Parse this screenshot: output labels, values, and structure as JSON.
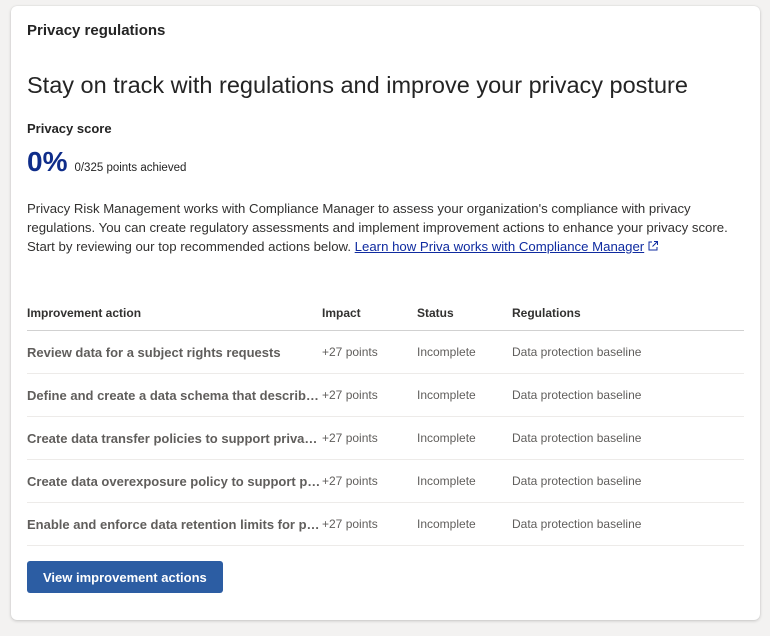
{
  "card": {
    "title": "Privacy regulations",
    "headline": "Stay on track with regulations and improve your privacy posture"
  },
  "score": {
    "label": "Privacy score",
    "value": "0%",
    "points": "0/325 points achieved"
  },
  "description": {
    "text": "Privacy Risk Management works with Compliance Manager to assess your organization's compliance with privacy regulations. You can create regulatory assessments and implement improvement actions to enhance your privacy score. Start by reviewing our top recommended actions below. ",
    "link_text": "Learn how Priva works with Compliance Manager",
    "link_icon": "external-link-icon"
  },
  "table": {
    "headers": {
      "action": "Improvement action",
      "impact": "Impact",
      "status": "Status",
      "regulations": "Regulations"
    },
    "rows": [
      {
        "action": "Review data for a subject rights requests",
        "impact": "+27 points",
        "status": "Incomplete",
        "regulations": "Data protection baseline"
      },
      {
        "action": "Define and create a data schema that describes personal data",
        "impact": "+27 points",
        "status": "Incomplete",
        "regulations": "Data protection baseline"
      },
      {
        "action": "Create data transfer policies to support privacy regulations",
        "impact": "+27 points",
        "status": "Incomplete",
        "regulations": "Data protection baseline"
      },
      {
        "action": "Create data overexposure policy to support privacy regulations",
        "impact": "+27 points",
        "status": "Incomplete",
        "regulations": "Data protection baseline"
      },
      {
        "action": "Enable and enforce data retention limits for personal data",
        "impact": "+27 points",
        "status": "Incomplete",
        "regulations": "Data protection baseline"
      }
    ]
  },
  "button": {
    "label": "View improvement actions"
  },
  "colors": {
    "score": "#0f2d8a",
    "link": "#0f2ba0",
    "button": "#2c5da3"
  }
}
